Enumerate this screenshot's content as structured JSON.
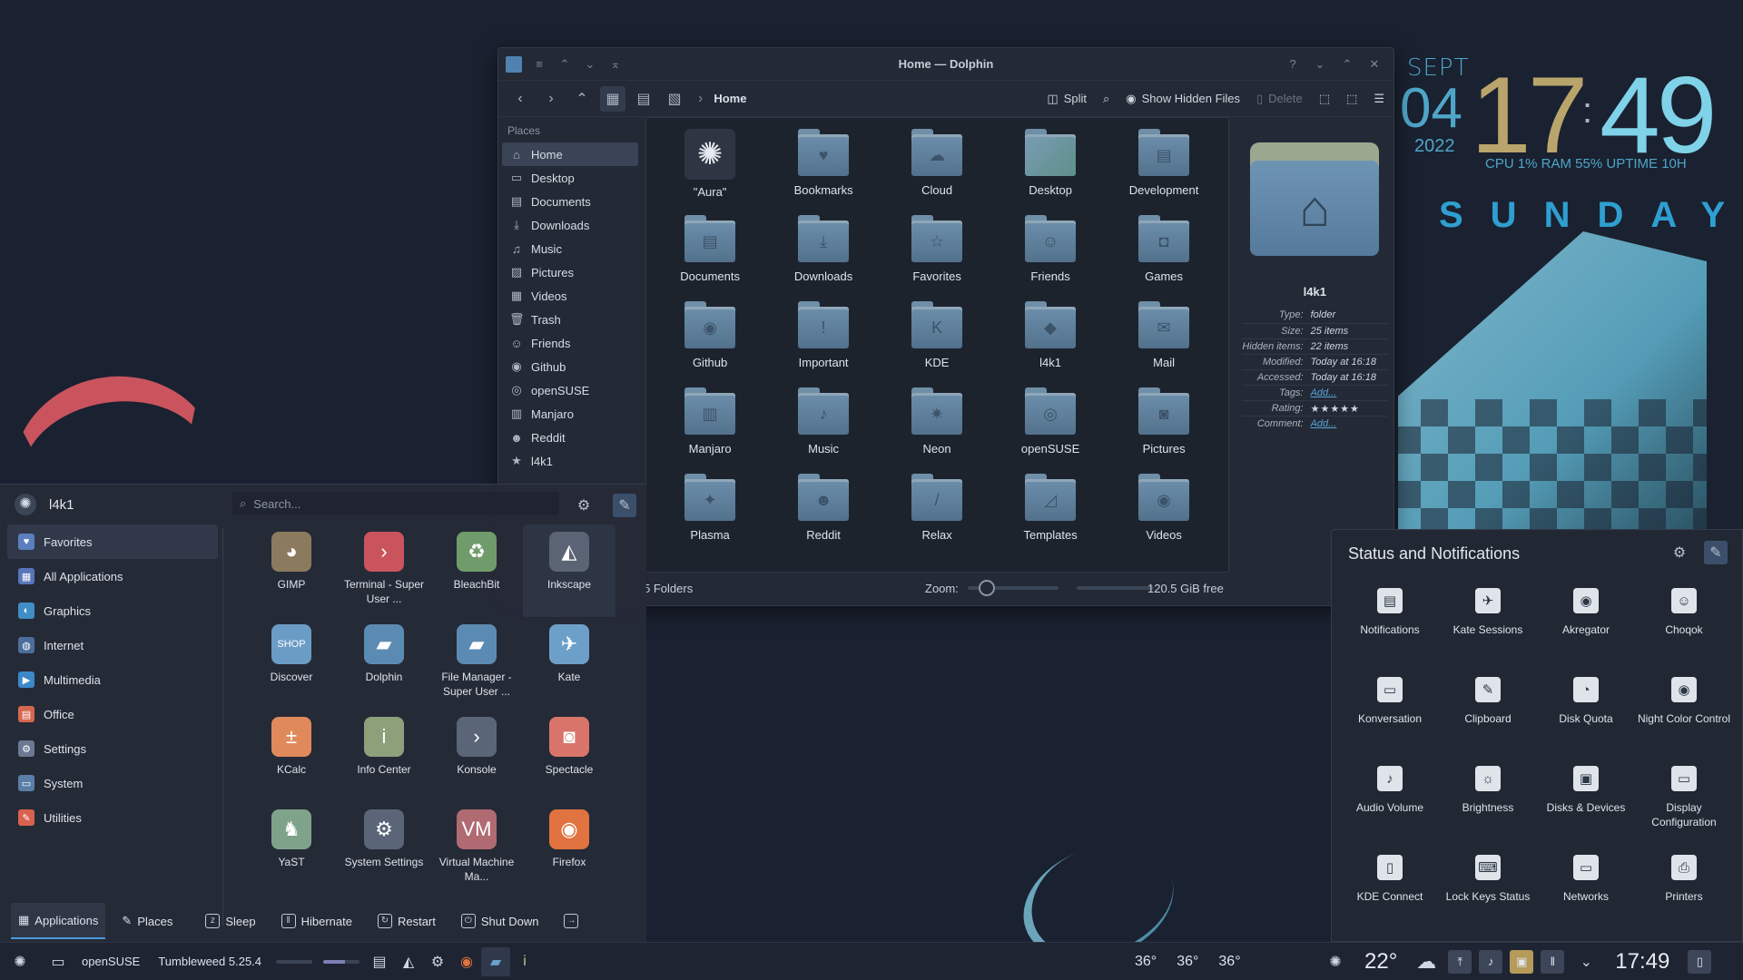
{
  "desktop": {
    "clock": {
      "month": "SEPT",
      "day": "04",
      "year": "2022",
      "hour": "17",
      "minute": "49",
      "stats": "CPU 1% RAM 55% UPTIME 10H",
      "weekday": "SUNDAY"
    }
  },
  "dolphin": {
    "title": "Home — Dolphin",
    "breadcrumb": "Home",
    "toolbar": {
      "split": "Split",
      "show_hidden": "Show Hidden Files",
      "delete": "Delete"
    },
    "places_header": "Places",
    "places": [
      {
        "label": "Home",
        "icon": "home-icon",
        "glyph": "⌂"
      },
      {
        "label": "Desktop",
        "icon": "desktop-icon",
        "glyph": "▭"
      },
      {
        "label": "Documents",
        "icon": "documents-icon",
        "glyph": "▤"
      },
      {
        "label": "Downloads",
        "icon": "download-icon",
        "glyph": "⤓"
      },
      {
        "label": "Music",
        "icon": "music-icon",
        "glyph": "♫"
      },
      {
        "label": "Pictures",
        "icon": "pictures-icon",
        "glyph": "▨"
      },
      {
        "label": "Videos",
        "icon": "videos-icon",
        "glyph": "▦"
      },
      {
        "label": "Trash",
        "icon": "trash-icon",
        "glyph": "🗑"
      },
      {
        "label": "Friends",
        "icon": "friends-icon",
        "glyph": "☺"
      },
      {
        "label": "Github",
        "icon": "github-icon",
        "glyph": "◉"
      },
      {
        "label": "openSUSE",
        "icon": "opensuse-icon",
        "glyph": "◎"
      },
      {
        "label": "Manjaro",
        "icon": "manjaro-icon",
        "glyph": "▥"
      },
      {
        "label": "Reddit",
        "icon": "reddit-icon",
        "glyph": "☻"
      },
      {
        "label": "l4k1",
        "icon": "star-icon",
        "glyph": "★"
      }
    ],
    "files": [
      {
        "label": "\"Aura\"",
        "icon": "aura-icon",
        "glyph": "✺",
        "kind": "aura"
      },
      {
        "label": "Bookmarks",
        "icon": "bookmarks-folder-icon",
        "glyph": "♥"
      },
      {
        "label": "Cloud",
        "icon": "cloud-folder-icon",
        "glyph": "☁"
      },
      {
        "label": "Desktop",
        "icon": "desktop-folder-icon",
        "glyph": "",
        "kind": "desk"
      },
      {
        "label": "Development",
        "icon": "development-folder-icon",
        "glyph": "▤"
      },
      {
        "label": "Documents",
        "icon": "documents-folder-icon",
        "glyph": "▤"
      },
      {
        "label": "Downloads",
        "icon": "downloads-folder-icon",
        "glyph": "⤓"
      },
      {
        "label": "Favorites",
        "icon": "favorites-folder-icon",
        "glyph": "☆"
      },
      {
        "label": "Friends",
        "icon": "friends-folder-icon",
        "glyph": "☺"
      },
      {
        "label": "Games",
        "icon": "games-folder-icon",
        "glyph": "◘"
      },
      {
        "label": "Github",
        "icon": "github-folder-icon",
        "glyph": "◉"
      },
      {
        "label": "Important",
        "icon": "important-folder-icon",
        "glyph": "!"
      },
      {
        "label": "KDE",
        "icon": "kde-folder-icon",
        "glyph": "K"
      },
      {
        "label": "l4k1",
        "icon": "l4k1-folder-icon",
        "glyph": "◆"
      },
      {
        "label": "Mail",
        "icon": "mail-folder-icon",
        "glyph": "✉"
      },
      {
        "label": "Manjaro",
        "icon": "manjaro-folder-icon",
        "glyph": "▥"
      },
      {
        "label": "Music",
        "icon": "music-folder-icon",
        "glyph": "♪"
      },
      {
        "label": "Neon",
        "icon": "neon-folder-icon",
        "glyph": "✷"
      },
      {
        "label": "openSUSE",
        "icon": "opensuse-folder-icon",
        "glyph": "◎"
      },
      {
        "label": "Pictures",
        "icon": "pictures-folder-icon",
        "glyph": "◙"
      },
      {
        "label": "Plasma",
        "icon": "plasma-folder-icon",
        "glyph": "✦"
      },
      {
        "label": "Reddit",
        "icon": "reddit-folder-icon",
        "glyph": "☻"
      },
      {
        "label": "Relax",
        "icon": "relax-folder-icon",
        "glyph": "/"
      },
      {
        "label": "Templates",
        "icon": "templates-folder-icon",
        "glyph": "◿"
      },
      {
        "label": "Videos",
        "icon": "videos-folder-icon",
        "glyph": "◉"
      }
    ],
    "info": {
      "name": "l4k1",
      "rows": [
        {
          "k": "Type:",
          "v": "folder"
        },
        {
          "k": "Size:",
          "v": "25 items"
        },
        {
          "k": "Hidden items:",
          "v": "22 items"
        },
        {
          "k": "Modified:",
          "v": "Today at 16:18"
        },
        {
          "k": "Accessed:",
          "v": "Today at 16:18"
        },
        {
          "k": "Tags:",
          "v": "Add...",
          "link": true
        },
        {
          "k": "Rating:",
          "v": "★★★★★",
          "stars": true
        },
        {
          "k": "Comment:",
          "v": "Add...",
          "link": true
        }
      ]
    },
    "status": {
      "folders": "5 Folders",
      "zoom_label": "Zoom:",
      "free": "120.5 GiB free"
    }
  },
  "launcher": {
    "user": "l4k1",
    "search_placeholder": "Search...",
    "categories": [
      {
        "label": "Favorites",
        "color": "#5b7fbf",
        "glyph": "♥"
      },
      {
        "label": "All Applications",
        "color": "#5775b8",
        "glyph": "▦"
      },
      {
        "label": "Graphics",
        "color": "#3f8fc6",
        "glyph": "◐"
      },
      {
        "label": "Internet",
        "color": "#4d6e9a",
        "glyph": "◍"
      },
      {
        "label": "Multimedia",
        "color": "#3c88c9",
        "glyph": "▶"
      },
      {
        "label": "Office",
        "color": "#d6674f",
        "glyph": "▤"
      },
      {
        "label": "Settings",
        "color": "#6b7a92",
        "glyph": "⚙"
      },
      {
        "label": "System",
        "color": "#5a7ea8",
        "glyph": "▭"
      },
      {
        "label": "Utilities",
        "color": "#d9614f",
        "glyph": "✎"
      }
    ],
    "apps": [
      {
        "label": "GIMP",
        "icon": "gimp-icon",
        "glyph": "◕",
        "color": "#8c7a5f"
      },
      {
        "label": "Terminal - Super User ...",
        "icon": "terminal-su-icon",
        "glyph": "›",
        "color": "#c9545e"
      },
      {
        "label": "BleachBit",
        "icon": "bleachbit-icon",
        "glyph": "♻",
        "color": "#6f9c6a"
      },
      {
        "label": "Inkscape",
        "icon": "inkscape-icon",
        "glyph": "◭",
        "color": "#5a6475"
      },
      {
        "label": "Discover",
        "icon": "discover-icon",
        "glyph": "SHOP",
        "color": "#6b9cc6"
      },
      {
        "label": "Dolphin",
        "icon": "dolphin-icon",
        "glyph": "▰",
        "color": "#5b8bb2"
      },
      {
        "label": "File Manager - Super User ...",
        "icon": "file-manager-su-icon",
        "glyph": "▰",
        "color": "#5b8bb2"
      },
      {
        "label": "Kate",
        "icon": "kate-icon",
        "glyph": "✈",
        "color": "#6da0c9"
      },
      {
        "label": "KCalc",
        "icon": "kcalc-icon",
        "glyph": "±",
        "color": "#e08a5c"
      },
      {
        "label": "Info Center",
        "icon": "info-center-icon",
        "glyph": "i",
        "color": "#8ea07a"
      },
      {
        "label": "Konsole",
        "icon": "konsole-icon",
        "glyph": "›",
        "color": "#5b6578"
      },
      {
        "label": "Spectacle",
        "icon": "spectacle-icon",
        "glyph": "◙",
        "color": "#d9746a"
      },
      {
        "label": "YaST",
        "icon": "yast-icon",
        "glyph": "♞",
        "color": "#7ea38a"
      },
      {
        "label": "System Settings",
        "icon": "system-settings-icon",
        "glyph": "⚙",
        "color": "#5a6578"
      },
      {
        "label": "Virtual Machine Ma...",
        "icon": "virt-manager-icon",
        "glyph": "VM",
        "color": "#b06a72"
      },
      {
        "label": "Firefox",
        "icon": "firefox-icon",
        "glyph": "◉",
        "color": "#e0733f"
      }
    ],
    "footer": {
      "applications": "Applications",
      "places": "Places",
      "sleep": "Sleep",
      "hibernate": "Hibernate",
      "restart": "Restart",
      "shutdown": "Shut Down"
    }
  },
  "notifications": {
    "title": "Status and Notifications",
    "items": [
      {
        "label": "Notifications",
        "icon": "notifications-icon",
        "glyph": "▤"
      },
      {
        "label": "Kate Sessions",
        "icon": "kate-sessions-icon",
        "glyph": "✈"
      },
      {
        "label": "Akregator",
        "icon": "akregator-icon",
        "glyph": "◉"
      },
      {
        "label": "Choqok",
        "icon": "choqok-icon",
        "glyph": "☺"
      },
      {
        "label": "Konversation",
        "icon": "konversation-icon",
        "glyph": "▭"
      },
      {
        "label": "Clipboard",
        "icon": "clipboard-icon",
        "glyph": "✎"
      },
      {
        "label": "Disk Quota",
        "icon": "disk-quota-icon",
        "glyph": "◔"
      },
      {
        "label": "Night Color Control",
        "icon": "night-color-icon",
        "glyph": "◉"
      },
      {
        "label": "Audio Volume",
        "icon": "audio-volume-icon",
        "glyph": "♪"
      },
      {
        "label": "Brightness",
        "icon": "brightness-icon",
        "glyph": "☼"
      },
      {
        "label": "Disks & Devices",
        "icon": "disks-devices-icon",
        "glyph": "▣"
      },
      {
        "label": "Display Configuration",
        "icon": "display-config-icon",
        "glyph": "▭"
      },
      {
        "label": "KDE Connect",
        "icon": "kde-connect-icon",
        "glyph": "▯"
      },
      {
        "label": "Lock Keys Status",
        "icon": "lock-keys-icon",
        "glyph": "⌨"
      },
      {
        "label": "Networks",
        "icon": "networks-icon",
        "glyph": "▭"
      },
      {
        "label": "Printers",
        "icon": "printers-icon",
        "glyph": "⎙"
      }
    ]
  },
  "taskbar": {
    "distro": "openSUSE",
    "version": "Tumbleweed 5.25.4",
    "temps": [
      "36°",
      "36°",
      "36°"
    ],
    "weather_temp": "22°",
    "time": "17:49"
  }
}
